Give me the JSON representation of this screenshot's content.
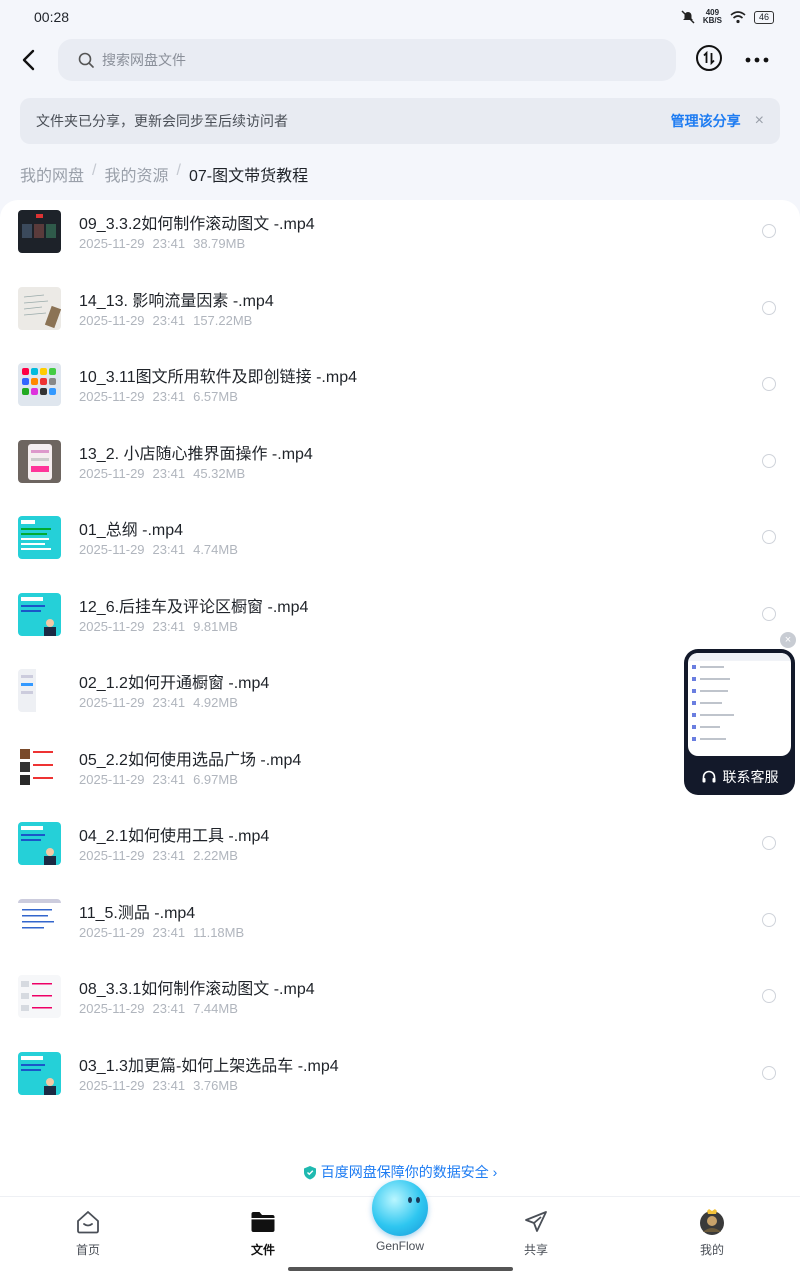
{
  "status": {
    "time": "00:28",
    "speed_value": "409",
    "speed_unit": "KB/S",
    "battery": "46"
  },
  "search": {
    "placeholder": "搜索网盘文件"
  },
  "share_banner": {
    "message": "文件夹已分享，更新会同步至后续访问者",
    "manage": "管理该分享",
    "close": "×"
  },
  "breadcrumb": {
    "root": "我的网盘",
    "level1": "我的资源",
    "current": "07-图文带货教程",
    "separator": "/"
  },
  "files": [
    {
      "name": "09_3.3.2如何制作滚动图文 -.mp4",
      "date": "2025-11-29",
      "time": "23:41",
      "size": "38.79MB",
      "thumb": "dark-video"
    },
    {
      "name": "14_13. 影响流量因素 -.mp4",
      "date": "2025-11-29",
      "time": "23:41",
      "size": "157.22MB",
      "thumb": "paper-notes"
    },
    {
      "name": "10_3.11图文所用软件及即创链接 -.mp4",
      "date": "2025-11-29",
      "time": "23:41",
      "size": "6.57MB",
      "thumb": "phone-apps"
    },
    {
      "name": "13_2. 小店随心推界面操作 -.mp4",
      "date": "2025-11-29",
      "time": "23:41",
      "size": "45.32MB",
      "thumb": "phone-screen"
    },
    {
      "name": "01_总纲 -.mp4",
      "date": "2025-11-29",
      "time": "23:41",
      "size": "4.74MB",
      "thumb": "cyan-slide"
    },
    {
      "name": "12_6.后挂车及评论区橱窗 -.mp4",
      "date": "2025-11-29",
      "time": "23:41",
      "size": "9.81MB",
      "thumb": "cyan-presenter"
    },
    {
      "name": "02_1.2如何开通橱窗 -.mp4",
      "date": "2025-11-29",
      "time": "23:41",
      "size": "4.92MB",
      "thumb": "white-phone"
    },
    {
      "name": "05_2.2如何使用选品广场 -.mp4",
      "date": "2025-11-29",
      "time": "23:41",
      "size": "6.97MB",
      "thumb": "product-list"
    },
    {
      "name": "04_2.1如何使用工具 -.mp4",
      "date": "2025-11-29",
      "time": "23:41",
      "size": "2.22MB",
      "thumb": "cyan-presenter"
    },
    {
      "name": "11_5.测品 -.mp4",
      "date": "2025-11-29",
      "time": "23:41",
      "size": "11.18MB",
      "thumb": "doc-page"
    },
    {
      "name": "08_3.3.1如何制作滚动图文 -.mp4",
      "date": "2025-11-29",
      "time": "23:41",
      "size": "7.44MB",
      "thumb": "white-list"
    },
    {
      "name": "03_1.3加更篇-如何上架选品车 -.mp4",
      "date": "2025-11-29",
      "time": "23:41",
      "size": "3.76MB",
      "thumb": "cyan-presenter"
    }
  ],
  "float_card": {
    "label": "联系客服",
    "close": "×"
  },
  "security_note": "百度网盘保障你的数据安全 ›",
  "nav": {
    "home": "首页",
    "files": "文件",
    "genflow": "GenFlow",
    "share": "共享",
    "mine": "我的"
  },
  "colors": {
    "accent": "#1e7cf2",
    "cyan_thumb": "#25d0d8",
    "float_bg": "#13192a"
  }
}
